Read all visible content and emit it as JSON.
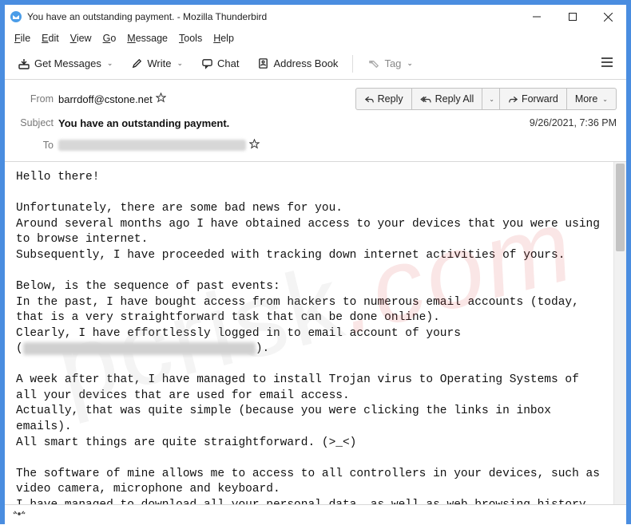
{
  "window": {
    "title": "You have an outstanding payment. - Mozilla Thunderbird"
  },
  "menu": {
    "file": "File",
    "edit": "Edit",
    "view": "View",
    "go": "Go",
    "message": "Message",
    "tools": "Tools",
    "help": "Help"
  },
  "toolbar": {
    "get_messages": "Get Messages",
    "write": "Write",
    "chat": "Chat",
    "address_book": "Address Book",
    "tag": "Tag"
  },
  "header": {
    "from_label": "From",
    "from_value": "barrdoff@cstone.net",
    "subject_label": "Subject",
    "subject_value": "You have an outstanding payment.",
    "to_label": "To",
    "date": "9/26/2021, 7:36 PM",
    "reply": "Reply",
    "reply_all": "Reply All",
    "forward": "Forward",
    "more": "More"
  },
  "body": {
    "p1": "Hello there!",
    "p2": "Unfortunately, there are some bad news for you.\nAround several months ago I have obtained access to your devices that you were using to browse internet.\nSubsequently, I have proceeded with tracking down internet activities of yours.",
    "p3a": "Below, is the sequence of past events:\nIn the past, I have bought access from hackers to numerous email accounts (today, that is a very straightforward task that can be done online).\nClearly, I have effortlessly logged in to email account of yours\n(",
    "p3b": ").",
    "p4": "A week after that, I have managed to install Trojan virus to Operating Systems of all your devices that are used for email access.\nActually, that was quite simple (because you were clicking the links in inbox emails).\nAll smart things are quite straightforward. (>_<)",
    "p5": "The software of mine allows me to access to all controllers in your devices, such as video camera, microphone and keyboard.\nI have managed to download all your personal data, as well as web browsing history and photos to my servers."
  },
  "watermark": {
    "a": "pcrisk",
    "b": ".com"
  }
}
